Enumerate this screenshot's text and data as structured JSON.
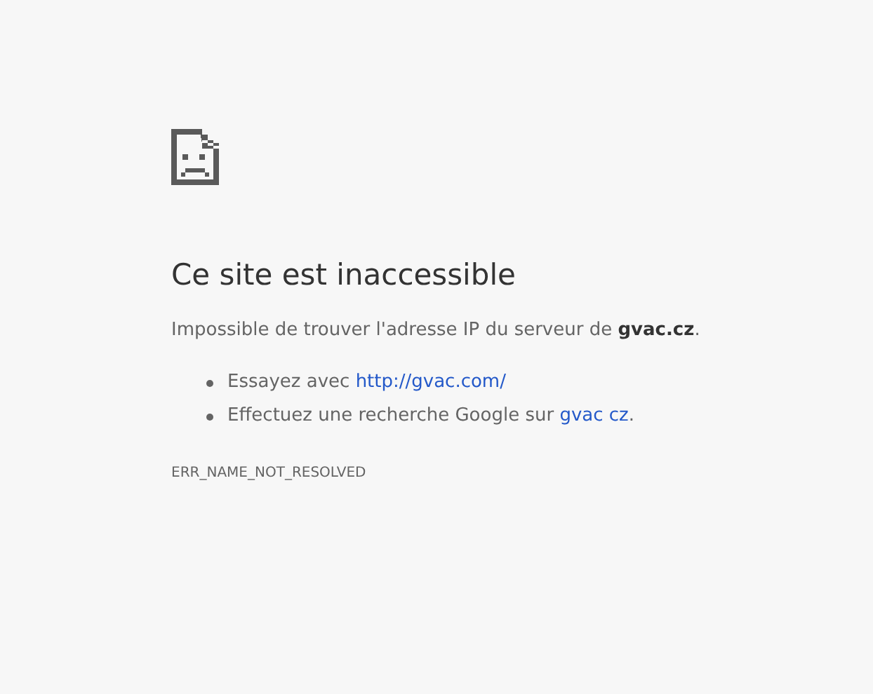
{
  "title": "Ce site est inaccessible",
  "message": "Impossible de trouver l'adresse IP du serveur de **gvac.cz**.",
  "suggestions": [
    {
      "text": "Essayez avec ",
      "link": "http://gvac.com/"
    },
    {
      "text": "Effectuez une recherche Google sur ",
      "link": "gvac cz",
      "after": "."
    }
  ],
  "error_code": "ERR_NAME_NOT_RESOLVED"
}
